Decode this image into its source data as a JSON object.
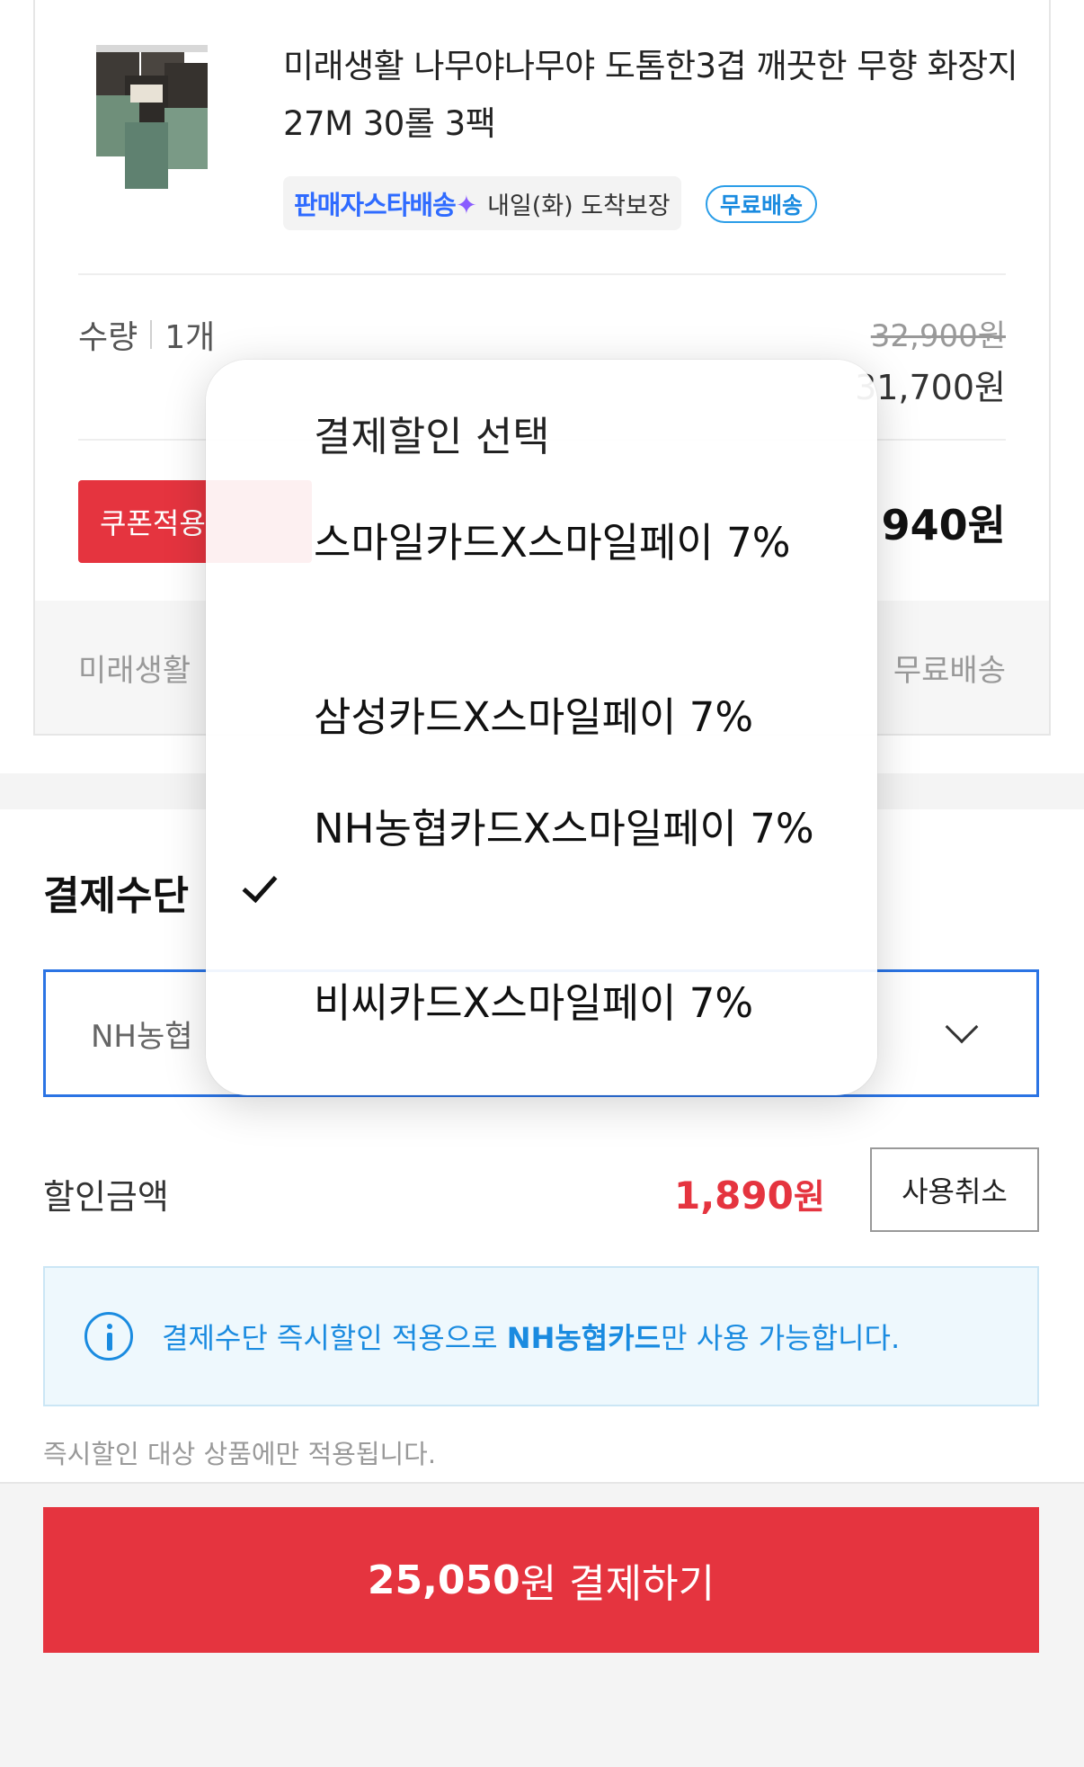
{
  "product": {
    "title": "미래생활 나무야나무야 도톰한3겹 깨끗한 무향 화장지 27M 30롤 3팩",
    "seller_star_label": "판매자스타배송",
    "arrival": "내일(화) 도착보장",
    "free_shipping_badge": "무료배송",
    "quantity_label": "수량",
    "quantity_value": "1개",
    "original_price": "32,900원",
    "sale_price": "31,700원",
    "coupon_button": "쿠폰적용",
    "final_price": "940원",
    "store_name": "미래생활",
    "store_shipping": "무료배송"
  },
  "payment": {
    "section_title": "결제수단",
    "selected_card": "NH농협",
    "discount_label": "할인금액",
    "discount_amount": "1,890",
    "discount_unit": "원",
    "cancel_button": "사용취소",
    "notice_prefix": "결제수단 즉시할인 적용으로 ",
    "notice_bold": "NH농협카드",
    "notice_suffix": "만 사용 가능합니다.",
    "sub_note": "즉시할인 대상 상품에만 적용됩니다.",
    "pay_amount": "25,050",
    "pay_suffix": "원 결제하기"
  },
  "dropdown": {
    "header": "결제할인 선택",
    "options": [
      {
        "label": "스마일카드X스마일페이 7%",
        "selected": false
      },
      {
        "label": "삼성카드X스마일페이 7%",
        "selected": false
      },
      {
        "label": "NH농협카드X스마일페이 7%",
        "selected": true
      },
      {
        "label": "비씨카드X스마일페이 7%",
        "selected": false
      }
    ]
  },
  "colors": {
    "accent_red": "#e5343f",
    "accent_blue": "#2b74e4",
    "info_blue": "#1a8be0"
  }
}
